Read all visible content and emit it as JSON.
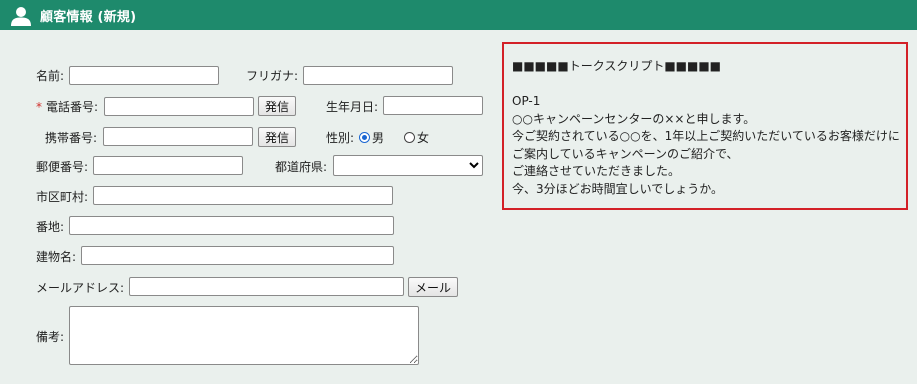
{
  "header": {
    "title": "顧客情報 (新規)"
  },
  "form": {
    "name": {
      "label": "名前:",
      "value": ""
    },
    "furigana": {
      "label": "フリガナ:",
      "value": ""
    },
    "phone": {
      "required_mark": "*",
      "label": "電話番号:",
      "value": "",
      "call_button": "発信"
    },
    "birthdate": {
      "label": "生年月日:",
      "value": ""
    },
    "mobile": {
      "label": "携帯番号:",
      "value": "",
      "call_button": "発信"
    },
    "gender": {
      "label": "性別:",
      "options": [
        "男",
        "女"
      ],
      "selected": "男"
    },
    "postal": {
      "label": "郵便番号:",
      "value": ""
    },
    "prefecture": {
      "label": "都道府県:",
      "value": ""
    },
    "city": {
      "label": "市区町村:",
      "value": ""
    },
    "street": {
      "label": "番地:",
      "value": ""
    },
    "building": {
      "label": "建物名:",
      "value": ""
    },
    "email": {
      "label": "メールアドレス:",
      "value": "",
      "mail_button": "メール"
    },
    "notes": {
      "label": "備考:",
      "value": ""
    }
  },
  "script": {
    "heading": "■■■■■トークスクリプト■■■■■",
    "code": "OP-1",
    "lines": [
      "○○キャンペーンセンターの××と申します。",
      "今ご契約されている○○を、1年以上ご契約いただいているお客様だけに",
      "ご案内しているキャンペーンのご紹介で、",
      "ご連絡させていただきました。",
      "今、3分ほどお時間宜しいでしょうか。"
    ]
  },
  "colors": {
    "header_bg": "#1e8a6c",
    "accent_border": "#d32027",
    "required": "#d0312d",
    "page_bg": "#eaf0ed"
  }
}
